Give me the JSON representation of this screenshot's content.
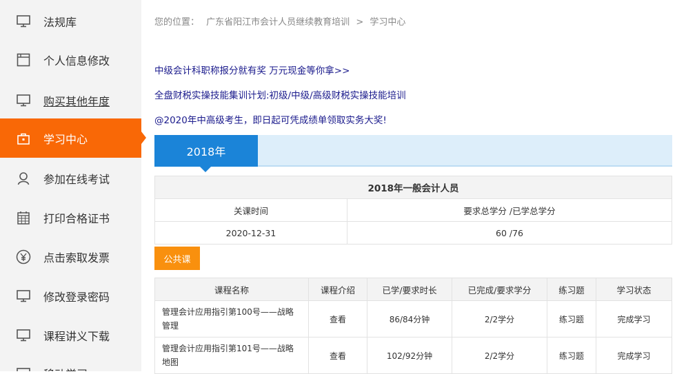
{
  "sidebar": {
    "items": [
      {
        "label": "法规库",
        "icon": "monitor-icon"
      },
      {
        "label": "个人信息修改",
        "icon": "document-icon"
      },
      {
        "label": "购买其他年度",
        "icon": "monitor-icon"
      },
      {
        "label": "学习中心",
        "icon": "bag-icon"
      },
      {
        "label": "参加在线考试",
        "icon": "user-icon"
      },
      {
        "label": "打印合格证书",
        "icon": "calendar-icon"
      },
      {
        "label": "点击索取发票",
        "icon": "yen-icon"
      },
      {
        "label": "修改登录密码",
        "icon": "monitor-icon"
      },
      {
        "label": "课程讲义下载",
        "icon": "monitor-icon"
      },
      {
        "label": "移动学习",
        "icon": "monitor-icon"
      }
    ],
    "active_color": "#f96806"
  },
  "breadcrumb": {
    "prefix": "您的位置：",
    "site": "广东省阳江市会计人员继续教育培训",
    "sep": ">",
    "current": "学习中心"
  },
  "promos": [
    "中级会计科职称报分就有奖 万元现金等你拿>>",
    "全盘财税实操技能集训计划:初级/中级/高级财税实操技能培训",
    "@2020年中高级考生，即日起可凭成绩单领取实务大奖!"
  ],
  "year_tab": "2018年",
  "summary": {
    "title": "2018年一般会计人员",
    "col1_header": "关课时间",
    "col2_header": "要求总学分 /已学总学分",
    "col1_value": "2020-12-31",
    "col2_value": "60 /76"
  },
  "public_button": "公共课",
  "courses": {
    "headers": [
      "课程名称",
      "课程介绍",
      "已学/要求时长",
      "已完成/要求学分",
      "练习题",
      "学习状态"
    ],
    "rows": [
      [
        "管理会计应用指引第100号——战略管理",
        "查看",
        "86/84分钟",
        "2/2学分",
        "练习题",
        "完成学习"
      ],
      [
        "管理会计应用指引第101号——战略地图",
        "查看",
        "102/92分钟",
        "2/2学分",
        "练习题",
        "完成学习"
      ]
    ]
  },
  "colors": {
    "accent_orange": "#f96806",
    "year_tab_blue": "#1b84d8",
    "promo_link": "#1a1a8c",
    "public_button": "#f9900e"
  }
}
